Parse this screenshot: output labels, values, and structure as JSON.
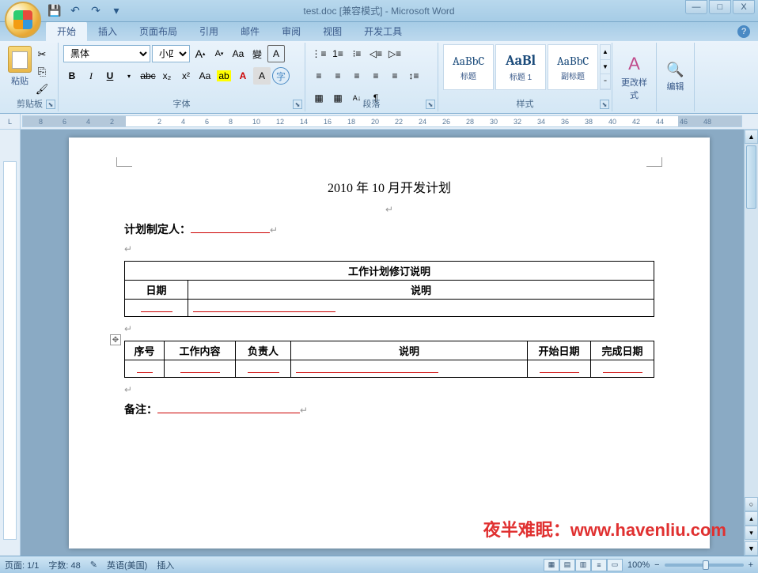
{
  "window": {
    "title": "test.doc [兼容模式] - Microsoft Word",
    "qat": {
      "save": "💾",
      "undo": "↶",
      "redo": "↷",
      "more": "▾"
    },
    "controls": {
      "min": "—",
      "max": "□",
      "close": "X"
    }
  },
  "tabs": [
    "开始",
    "插入",
    "页面布局",
    "引用",
    "邮件",
    "审阅",
    "视图",
    "开发工具"
  ],
  "ribbon": {
    "clipboard": {
      "paste": "粘贴",
      "label": "剪贴板"
    },
    "font": {
      "name": "黑体",
      "size": "小四",
      "grow": "A",
      "shrink": "A",
      "clear": "Aa",
      "pinyin": "變",
      "border": "A",
      "bold": "B",
      "italic": "I",
      "underline": "U",
      "strike": "abc",
      "sub": "x₂",
      "sup": "x²",
      "case": "Aa",
      "highlight": "ab",
      "color": "A",
      "charbg": "A",
      "charfit": "字",
      "label": "字体"
    },
    "para": {
      "bullets": "≡",
      "numbers": "≡",
      "multilevel": "≡",
      "dedent": "◀",
      "indent": "▶",
      "left": "≡",
      "center": "≡",
      "right": "≡",
      "justify": "≡",
      "dist": "≡",
      "spacing": "↕",
      "sort": "A↓",
      "show": "¶",
      "shade": "▦",
      "borders": "▦",
      "label": "段落"
    },
    "styles": {
      "items": [
        {
          "preview": "AaBbC",
          "name": "标题"
        },
        {
          "preview": "AaBl",
          "name": "标题 1"
        },
        {
          "preview": "AaBbC",
          "name": "副标题"
        }
      ],
      "change": "更改样式",
      "label": "样式"
    },
    "editing": {
      "label": "编辑"
    }
  },
  "ruler": {
    "marks": [
      "8",
      "6",
      "4",
      "2",
      "",
      "2",
      "4",
      "6",
      "8",
      "10",
      "12",
      "14",
      "16",
      "18",
      "20",
      "22",
      "24",
      "26",
      "28",
      "30",
      "32",
      "34",
      "36",
      "38",
      "40",
      "42",
      "44",
      "46",
      "48"
    ]
  },
  "document": {
    "title": "2010 年 10 月开发计划",
    "planner_label": "计划制定人：",
    "table1": {
      "header": "工作计划修订说明",
      "col1": "日期",
      "col2": "说明"
    },
    "table2": {
      "cols": [
        "序号",
        "工作内容",
        "负责人",
        "说明",
        "开始日期",
        "完成日期"
      ]
    },
    "remark_label": "备注："
  },
  "status": {
    "page": "页面: 1/1",
    "words": "字数: 48",
    "lang": "英语(美国)",
    "mode": "插入",
    "zoom": "100%"
  },
  "watermark": "夜半难眠：www.havenliu.com"
}
